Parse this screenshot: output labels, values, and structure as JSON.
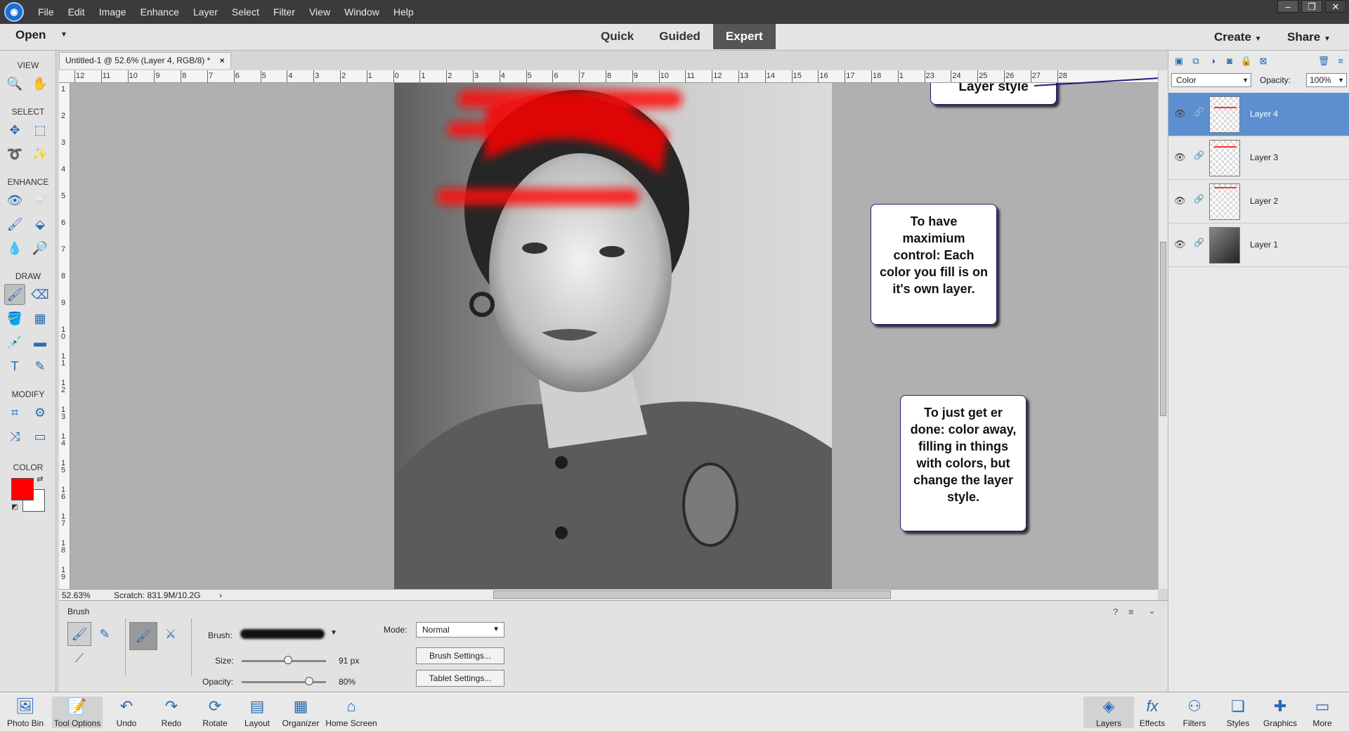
{
  "menubar": {
    "items": [
      "File",
      "Edit",
      "Image",
      "Enhance",
      "Layer",
      "Select",
      "Filter",
      "View",
      "Window",
      "Help"
    ]
  },
  "window_controls": {
    "minimize": "–",
    "restore": "❐",
    "close": "✕"
  },
  "modebar": {
    "open_label": "Open",
    "modes": [
      "Quick",
      "Guided",
      "Expert"
    ],
    "active_mode": "Expert",
    "create_label": "Create",
    "share_label": "Share"
  },
  "toolbox": {
    "groups": [
      "VIEW",
      "SELECT",
      "ENHANCE",
      "DRAW",
      "MODIFY",
      "COLOR"
    ],
    "foreground_color": "#ff0000",
    "background_color": "#ffffff"
  },
  "document": {
    "tab_title": "Untitled-1 @ 52.6% (Layer 4, RGB/8) *",
    "zoom": "52.63%",
    "scratch": "Scratch: 831.9M/10.2G"
  },
  "rulers": {
    "top": [
      "12",
      "11",
      "10",
      "9",
      "8",
      "7",
      "6",
      "5",
      "4",
      "3",
      "2",
      "1",
      "0",
      "1",
      "2",
      "3",
      "4",
      "5",
      "6",
      "7",
      "8",
      "9",
      "10",
      "11",
      "12",
      "13",
      "14",
      "15",
      "16",
      "17",
      "18",
      "1",
      "23",
      "24",
      "25",
      "26",
      "27",
      "28"
    ],
    "left": [
      "1",
      "2",
      "3",
      "4",
      "5",
      "6",
      "7",
      "8",
      "9",
      "10",
      "11",
      "12",
      "13",
      "14",
      "15",
      "16",
      "17",
      "18",
      "19"
    ]
  },
  "layers_panel": {
    "blend_mode": "Color",
    "opacity_label": "Opacity:",
    "opacity_value": "100%",
    "layers": [
      {
        "name": "Layer 4",
        "selected": true,
        "thumb": "red-line-top"
      },
      {
        "name": "Layer 3",
        "selected": false,
        "thumb": "red-line-mid"
      },
      {
        "name": "Layer 2",
        "selected": false,
        "thumb": "red-line-upper"
      },
      {
        "name": "Layer 1",
        "selected": false,
        "thumb": "photo"
      }
    ]
  },
  "tool_options": {
    "title": "Brush",
    "brush_label": "Brush:",
    "size_label": "Size:",
    "size_value": "91 px",
    "size_fraction": 0.55,
    "opacity_label": "Opacity:",
    "opacity_value": "80%",
    "opacity_fraction": 0.8,
    "mode_label": "Mode:",
    "mode_value": "Normal",
    "brush_settings": "Brush Settings...",
    "tablet_settings": "Tablet Settings..."
  },
  "taskbar": {
    "left": [
      "Photo Bin",
      "Tool Options",
      "Undo",
      "Redo",
      "Rotate",
      "Layout",
      "Organizer",
      "Home Screen"
    ],
    "right": [
      "Layers",
      "Effects",
      "Filters",
      "Styles",
      "Graphics",
      "More"
    ]
  },
  "callouts": {
    "layer_style": "Layer style",
    "max_control": "To have maximium control:  Each color you fill is on it's own layer.",
    "get_done": "To just get er done:  color away, filling in things with colors, but change the layer style."
  }
}
